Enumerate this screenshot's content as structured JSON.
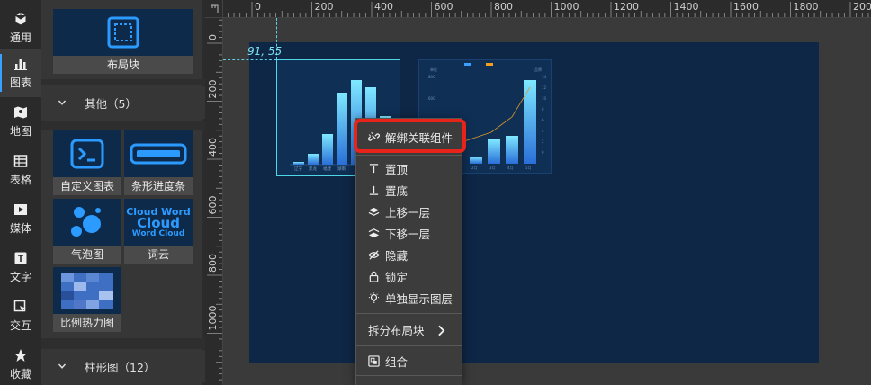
{
  "rail": [
    {
      "label": "通用",
      "icon": "cube-icon"
    },
    {
      "label": "图表",
      "icon": "bar-chart-icon",
      "active": true
    },
    {
      "label": "地图",
      "icon": "map-icon"
    },
    {
      "label": "表格",
      "icon": "table-icon"
    },
    {
      "label": "媒体",
      "icon": "media-icon"
    },
    {
      "label": "文字",
      "icon": "text-icon"
    },
    {
      "label": "交互",
      "icon": "interaction-icon"
    },
    {
      "label": "收藏",
      "icon": "star-icon"
    }
  ],
  "panel": {
    "layout_block_label": "布局块",
    "section_other": "其他（5）",
    "cards": [
      {
        "label": "自定义图表"
      },
      {
        "label": "条形进度条"
      },
      {
        "label": "气泡图"
      },
      {
        "label": "词云"
      },
      {
        "label": "比例热力图"
      }
    ],
    "wordcloud_text": {
      "line1": "Cloud Word",
      "line2": "Cloud",
      "line3": "Word Cloud"
    },
    "section_bar": "柱形图（12）"
  },
  "ruler": {
    "top_ticks": [
      "0",
      "200",
      "400",
      "600",
      "800",
      "1000",
      "1200",
      "1400",
      "1600",
      "1800",
      "2000"
    ],
    "left_ticks": [
      "0",
      "200",
      "400",
      "600",
      "800",
      "1000"
    ]
  },
  "canvas": {
    "coord_readout": "91, 55"
  },
  "menu": {
    "items": [
      {
        "label": "解绑关联组件",
        "icon": "unlink-icon"
      },
      {
        "label": "置顶",
        "icon": "bring-to-top-icon"
      },
      {
        "label": "置底",
        "icon": "send-to-bottom-icon"
      },
      {
        "label": "上移一层",
        "icon": "layer-up-icon"
      },
      {
        "label": "下移一层",
        "icon": "layer-down-icon"
      },
      {
        "label": "隐藏",
        "icon": "hide-icon"
      },
      {
        "label": "锁定",
        "icon": "lock-icon"
      },
      {
        "label": "单独显示图层",
        "icon": "solo-layer-icon"
      },
      {
        "label": "拆分布局块",
        "icon": ""
      },
      {
        "label": "组合",
        "icon": "group-icon"
      }
    ]
  },
  "colors": {
    "accent": "#3aa0ff",
    "artboard": "#0e2746",
    "selection": "#4fd7e8",
    "highlight": "#e8231a"
  }
}
